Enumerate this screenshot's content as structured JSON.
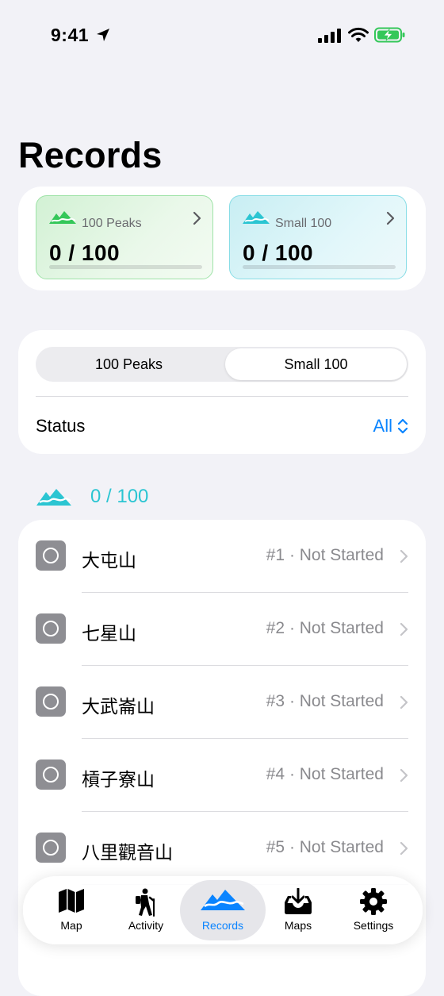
{
  "status_bar": {
    "time": "9:41"
  },
  "page": {
    "title": "Records"
  },
  "summary": {
    "cards": [
      {
        "label": "100 Peaks",
        "count": "0 / 100",
        "progress": 0
      },
      {
        "label": "Small 100",
        "count": "0 / 100",
        "progress": 0
      }
    ]
  },
  "filter": {
    "segments": [
      "100 Peaks",
      "Small 100"
    ],
    "selected_segment": "Small 100",
    "status_label": "Status",
    "status_value": "All"
  },
  "section": {
    "count": "0 / 100"
  },
  "peaks": [
    {
      "name": "大屯山",
      "meta": "#1 · Not Started"
    },
    {
      "name": "七星山",
      "meta": "#2 · Not Started"
    },
    {
      "name": "大武崙山",
      "meta": "#3 · Not Started"
    },
    {
      "name": "槓子寮山",
      "meta": "#4 · Not Started"
    },
    {
      "name": "八里觀音山",
      "meta": "#5 · Not Started"
    }
  ],
  "tab_bar": {
    "active": "Records",
    "tabs": [
      {
        "label": "Map",
        "icon": "map-icon"
      },
      {
        "label": "Activity",
        "icon": "hiker-icon"
      },
      {
        "label": "Records",
        "icon": "mountains-icon"
      },
      {
        "label": "Maps",
        "icon": "download-tray-icon"
      },
      {
        "label": "Settings",
        "icon": "gear-icon"
      }
    ]
  },
  "colors": {
    "accent": "#0a84ff",
    "teal": "#2bc5d2",
    "green": "#34c759"
  }
}
